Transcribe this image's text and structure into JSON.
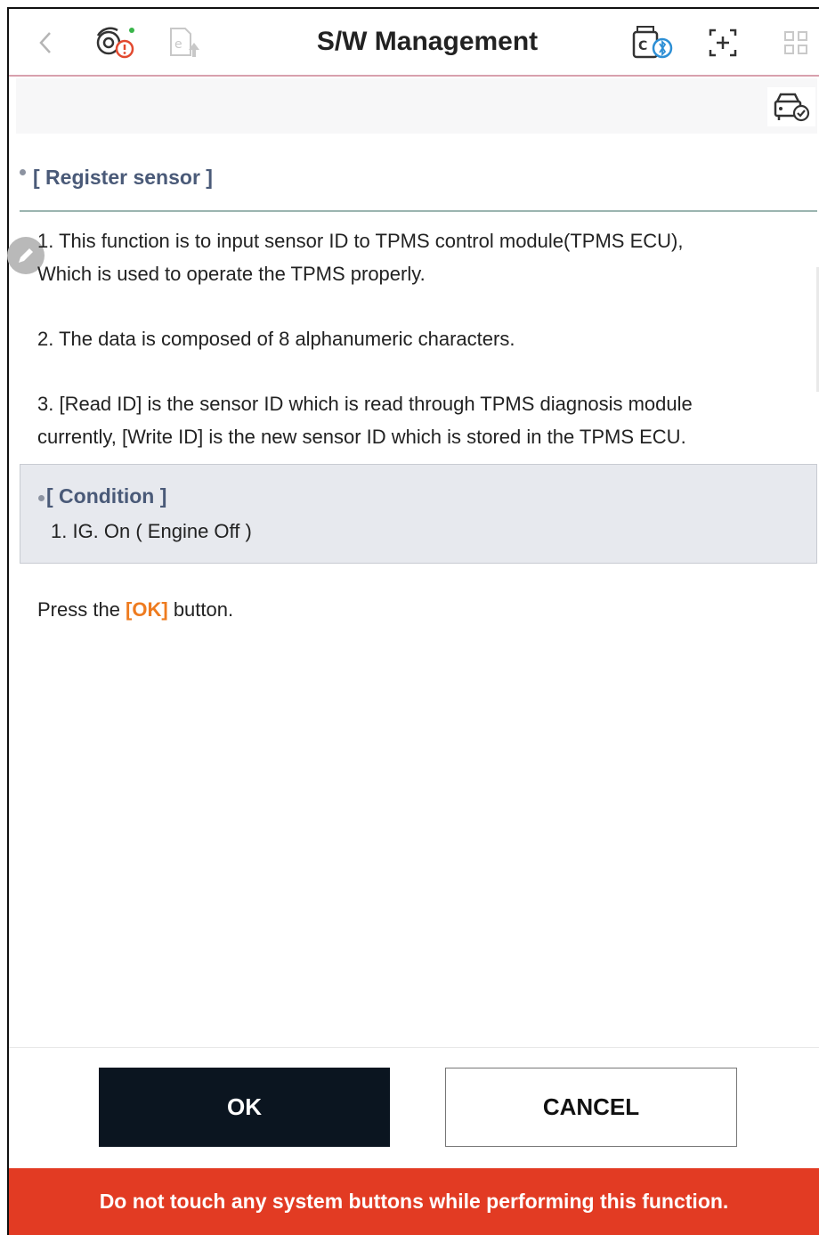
{
  "header": {
    "title": "S/W Management",
    "icons": [
      "back-icon",
      "vehicle-diagnosis-alert-icon",
      "export-report-icon",
      "vci-bluetooth-icon",
      "screen-capture-icon",
      "apps-grid-icon"
    ]
  },
  "subbar": {
    "icon": "vehicle-check-icon"
  },
  "section": {
    "title": "[ Register sensor ]"
  },
  "instructions": {
    "p1_line1": "1. This function is to input sensor ID to TPMS control module(TPMS ECU),",
    "p1_line2": "Which is used to operate the TPMS properly.",
    "p2": "2. The data is composed of 8 alphanumeric characters.",
    "p3_line1": "3. [Read ID] is the sensor ID which is read through TPMS diagnosis module",
    "p3_line2": "currently, [Write ID] is the new sensor ID which is stored in the TPMS ECU."
  },
  "condition": {
    "title": "[ Condition ]",
    "item": "1. IG. On ( Engine Off )"
  },
  "prompt": {
    "before": "Press the ",
    "highlight": "[OK]",
    "after": " button."
  },
  "buttons": {
    "ok": "OK",
    "cancel": "CANCEL"
  },
  "warning": {
    "text": "Do not touch any system buttons while performing this function."
  },
  "colors": {
    "accent_orange": "#ee7b1f",
    "warning_red": "#e23b23",
    "ok_button": "#0b1520",
    "section_title": "#4a5a78"
  }
}
